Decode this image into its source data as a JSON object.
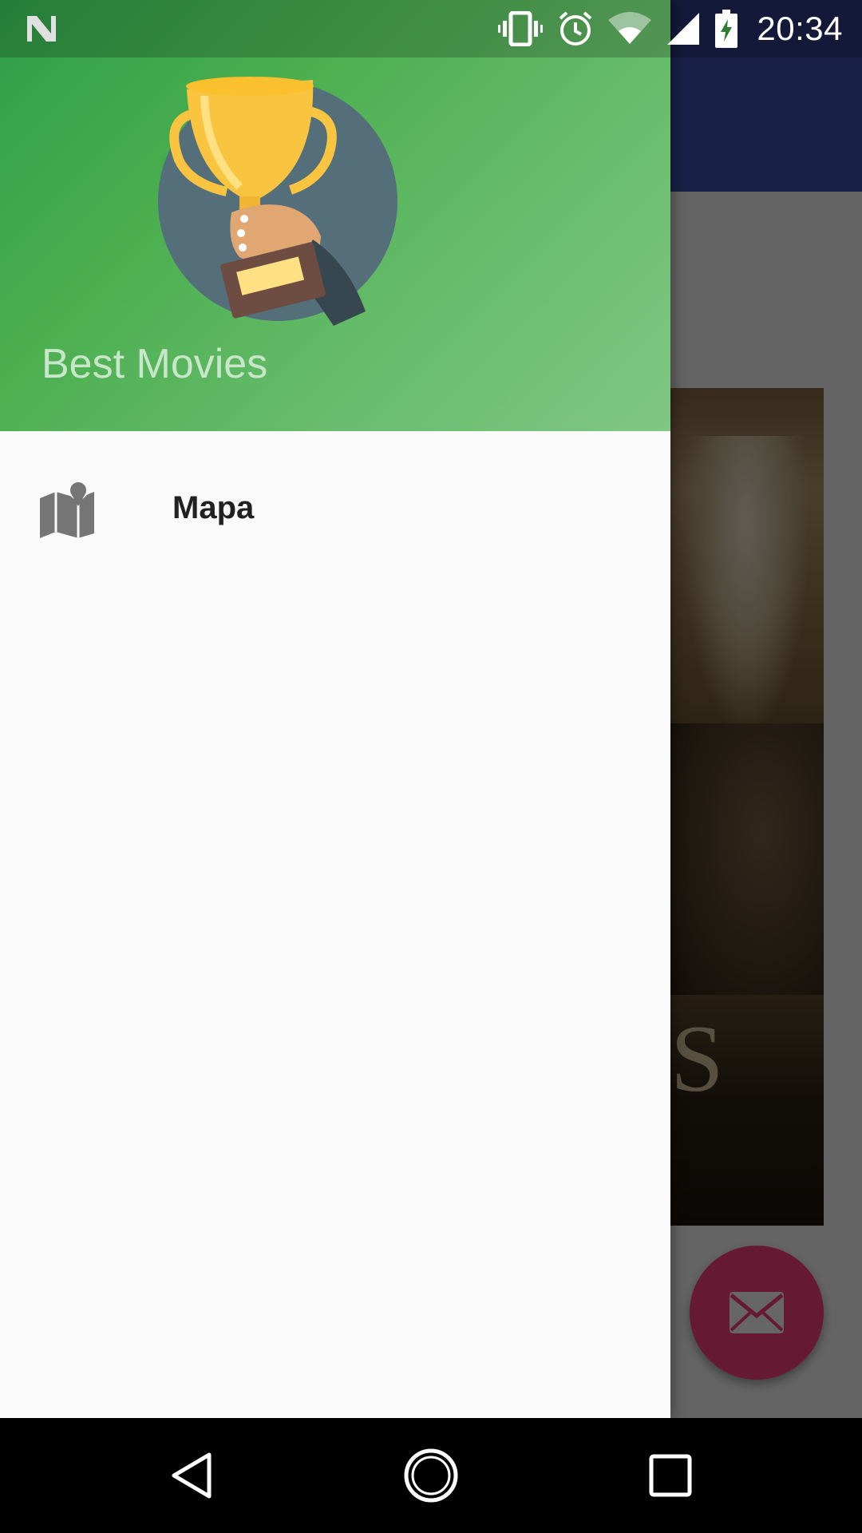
{
  "status_bar": {
    "time": "20:34",
    "icons": [
      "notification-n-icon",
      "vibrate-icon",
      "alarm-icon",
      "wifi-icon",
      "signal-icon",
      "battery-charging-icon"
    ]
  },
  "drawer": {
    "header": {
      "title": "Best Movies",
      "avatar_icon": "trophy-in-hand-icon"
    },
    "menu_items": [
      {
        "label": "Mapa",
        "icon": "map-icon"
      }
    ]
  },
  "background_app": {
    "fab_icon": "mail-icon",
    "poster_partial_text": "S"
  },
  "nav_bar": {
    "buttons": [
      "back-icon",
      "home-icon",
      "recents-icon"
    ]
  },
  "colors": {
    "drawer_header_gradient_start": "#2e9e48",
    "drawer_header_gradient_end": "#81c784",
    "header_title_color": "#c8e6c9",
    "toolbar_primary": "#3f51b5",
    "fab_accent": "#ff4081",
    "drawer_background": "#fafafa",
    "nav_bar": "#000000"
  }
}
